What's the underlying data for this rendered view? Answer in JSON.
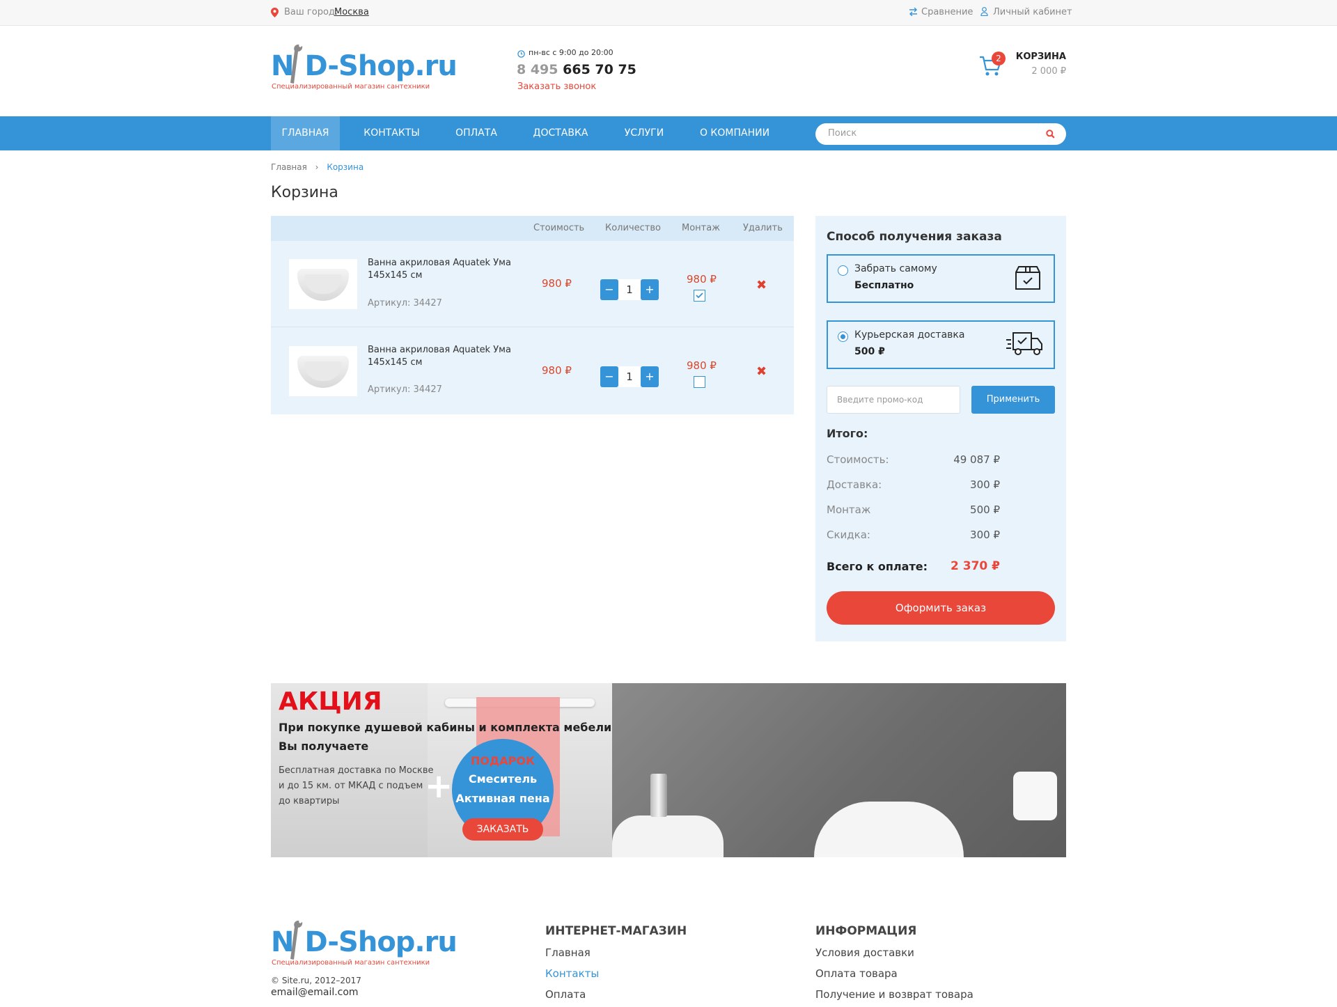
{
  "topbar": {
    "city_label": "Ваш город:",
    "city_value": "Москва",
    "compare": "Сравнение",
    "account": "Личный кабинет"
  },
  "header": {
    "logo_part1": "N",
    "logo_part2": "D-",
    "logo_part3": "Shop.ru",
    "logo_tagline": "Специализированный магазин сантехники",
    "hours": "пн-вс с 9:00 до 20:00",
    "phone_code": "8 495",
    "phone_number": "665 70 75",
    "callback": "Заказать звонок",
    "cart_count": "2",
    "cart_label": "КОРЗИНА",
    "cart_total": "2 000 ₽"
  },
  "nav": {
    "items": [
      "ГЛАВНАЯ",
      "КОНТАКТЫ",
      "ОПЛАТА",
      "ДОСТАВКА",
      "УСЛУГИ",
      "О КОМПАНИИ"
    ],
    "search_placeholder": "Поиск"
  },
  "breadcrumb": {
    "home": "Главная",
    "sep": "›",
    "current": "Корзина"
  },
  "page_title": "Корзина",
  "cart": {
    "columns": {
      "price": "Стоимость",
      "qty": "Количество",
      "install": "Монтаж",
      "delete": "Удалить"
    },
    "items": [
      {
        "name": "Ванна акриловая Aquatek Ума 145x145 см",
        "sku": "Артикул: 34427",
        "price": "980 ₽",
        "qty": "1",
        "install_price": "980 ₽",
        "install_checked": true
      },
      {
        "name": "Ванна акриловая Aquatek Ума 145x145 см",
        "sku": "Артикул: 34427",
        "price": "980 ₽",
        "qty": "1",
        "install_price": "980 ₽",
        "install_checked": false
      }
    ],
    "minus": "−",
    "plus": "+",
    "delete_icon": "✖"
  },
  "sidebar": {
    "title": "Способ получения заказа",
    "options": [
      {
        "label": "Забрать самому",
        "price": "Бесплатно",
        "selected": false,
        "icon": "box-icon"
      },
      {
        "label": "Курьерская доставка",
        "price": "500 ₽",
        "selected": true,
        "icon": "truck-icon"
      }
    ],
    "promo_placeholder": "Введите промо-код",
    "apply": "Применить",
    "total_title": "Итого:",
    "rows": [
      {
        "label": "Стоимость:",
        "value": "49 087 ₽"
      },
      {
        "label": "Доставка:",
        "value": "300 ₽"
      },
      {
        "label": "Монтаж",
        "value": "500 ₽"
      },
      {
        "label": "Скидка:",
        "value": "300 ₽"
      }
    ],
    "grand_label": "Всего к оплате:",
    "grand_value": "2 370 ₽",
    "order_button": "Оформить заказ"
  },
  "banner": {
    "title": "АКЦИЯ",
    "line1": "При покупке душевой кабины и комплекта мебели",
    "line2": "Вы получаете",
    "desc1": "Бесплатная доставка по Москве",
    "desc2": "и до 15 км. от МКАД с подъем",
    "desc3": "до квартиры",
    "plus": "+",
    "gift_label": "ПОДАРОК",
    "gift_line1": "Смеситель",
    "gift_line2": "Активная пена",
    "order_button": "ЗАКАЗАТЬ"
  },
  "footer": {
    "copyright": "© Site.ru, 2012–2017",
    "email": "email@email.com",
    "shop_title": "ИНТЕРНЕТ-МАГАЗИН",
    "shop_links": [
      "Главная",
      "Контакты",
      "Оплата"
    ],
    "info_title": "ИНФОРМАЦИЯ",
    "info_links": [
      "Условия доставки",
      "Оплата товара",
      "Получение и возврат товара"
    ]
  },
  "colors": {
    "accent": "#3593d8",
    "red": "#e8473a",
    "panel": "#e8f3fb"
  }
}
